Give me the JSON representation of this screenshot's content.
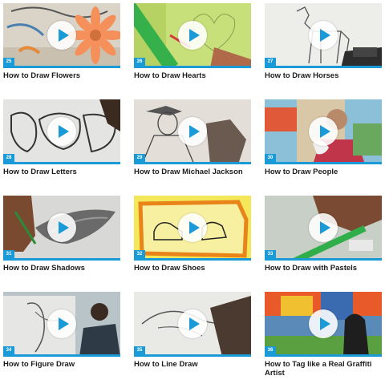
{
  "videos": [
    {
      "num": "25",
      "title": "How to Draw Flowers",
      "icon": "play-icon"
    },
    {
      "num": "26",
      "title": "How to Draw Hearts",
      "icon": "play-icon"
    },
    {
      "num": "27",
      "title": "How to Draw Horses",
      "icon": "play-icon"
    },
    {
      "num": "28",
      "title": "How to Draw Letters",
      "icon": "play-icon"
    },
    {
      "num": "29",
      "title": "How to Draw Michael Jackson",
      "icon": "play-icon"
    },
    {
      "num": "30",
      "title": "How to Draw People",
      "icon": "play-icon"
    },
    {
      "num": "31",
      "title": "How to Draw Shadows",
      "icon": "play-icon"
    },
    {
      "num": "32",
      "title": "How to Draw Shoes",
      "icon": "play-icon"
    },
    {
      "num": "33",
      "title": "How to Draw with Pastels",
      "icon": "play-icon"
    },
    {
      "num": "34",
      "title": "How to Figure Draw",
      "icon": "play-icon"
    },
    {
      "num": "35",
      "title": "How to Line Draw",
      "icon": "play-icon"
    },
    {
      "num": "36",
      "title": "How to Tag like a Real Graffiti Artist",
      "icon": "play-icon"
    }
  ],
  "colors": {
    "accent": "#1a9bd7"
  }
}
